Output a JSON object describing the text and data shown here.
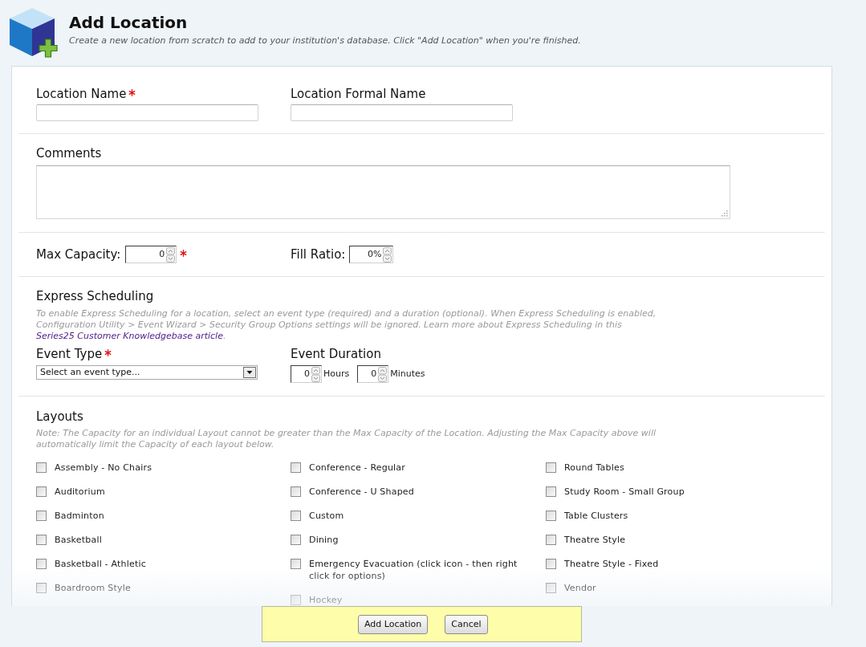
{
  "header": {
    "title": "Add Location",
    "subtitle": "Create a new location from scratch to add to your institution's database. Click \"Add Location\" when you're finished."
  },
  "name_fields": [
    {
      "label": "Location Name",
      "required": true
    },
    {
      "label": "Location Formal Name",
      "required": false
    }
  ],
  "comments": {
    "label": "Comments"
  },
  "capacity_fields": [
    {
      "label": "Max Capacity:",
      "value": "0",
      "required": true
    },
    {
      "label": "Fill Ratio:",
      "value": "0%",
      "required": false
    }
  ],
  "express_scheduling": {
    "heading": "Express Scheduling",
    "description": "To enable Express Scheduling for a location, select an event type (required) and a duration (optional). When Express Scheduling is enabled, Configuration Utility > Event Wizard > Security Group Options settings will be ignored. Learn more about Express Scheduling in this",
    "link": "Series25 Customer Knowledgebase article",
    "after_link": ".",
    "event_type": {
      "label": "Event Type",
      "required": true,
      "value": "Select an event type..."
    },
    "event_duration": {
      "label": "Event Duration",
      "fields": [
        {
          "value": "0",
          "unit": "Hours"
        },
        {
          "value": "0",
          "unit": "Minutes"
        }
      ]
    }
  },
  "layouts": {
    "heading": "Layouts",
    "note": "Note: The Capacity for an individual Layout cannot be greater than the Max Capacity of the Location. Adjusting the Max Capacity above will automatically limit the Capacity of each layout below.",
    "columns": [
      [
        {
          "label": "Assembly - No Chairs",
          "checked": false
        },
        {
          "label": "Auditorium",
          "checked": false
        },
        {
          "label": "Badminton",
          "checked": false
        },
        {
          "label": "Basketball",
          "checked": false
        },
        {
          "label": "Basketball - Athletic",
          "checked": false
        },
        {
          "label": "Boardroom Style",
          "checked": false
        }
      ],
      [
        {
          "label": "Conference - Regular",
          "checked": false
        },
        {
          "label": "Conference - U Shaped",
          "checked": false
        },
        {
          "label": "Custom",
          "checked": false
        },
        {
          "label": "Dining",
          "checked": false
        },
        {
          "label": "Emergency Evacuation (click icon - then right click for options)",
          "checked": false
        },
        {
          "label": "Hockey",
          "checked": false
        }
      ],
      [
        {
          "label": "Round Tables",
          "checked": false
        },
        {
          "label": "Study Room - Small Group",
          "checked": false
        },
        {
          "label": "Table Clusters",
          "checked": false
        },
        {
          "label": "Theatre Style",
          "checked": false
        },
        {
          "label": "Theatre Style - Fixed",
          "checked": false
        },
        {
          "label": "Vendor",
          "checked": false
        }
      ]
    ]
  },
  "footer": {
    "buttons": [
      "Add Location",
      "Cancel"
    ]
  }
}
